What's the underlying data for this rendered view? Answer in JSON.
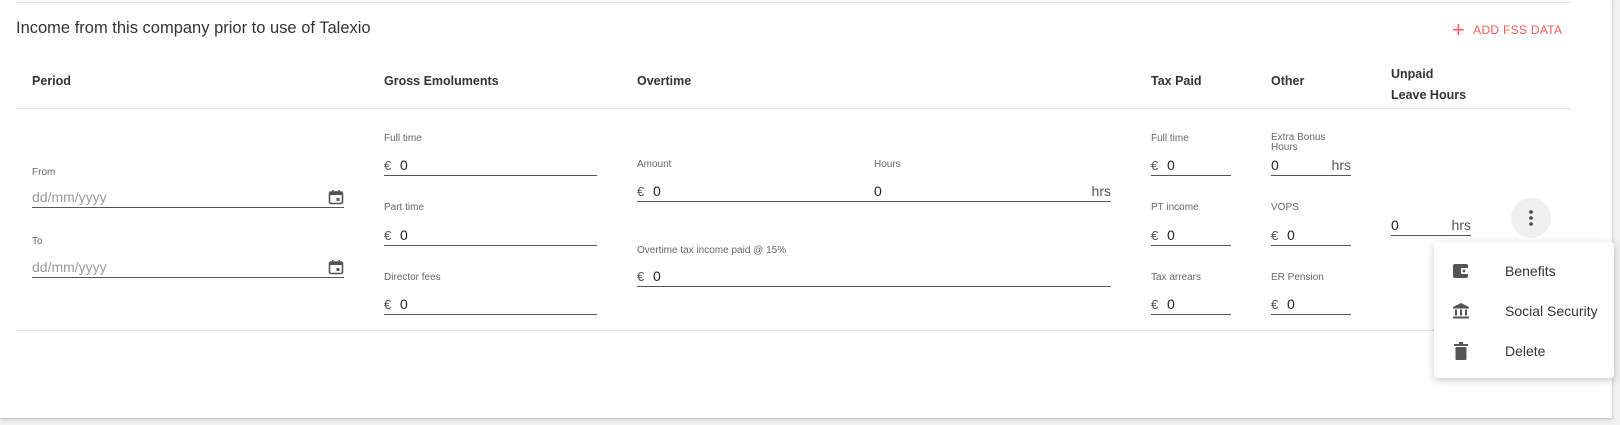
{
  "section": {
    "title": "Income from this company prior to use of Talexio",
    "add_button": "ADD FSS DATA"
  },
  "columns": {
    "period": "Period",
    "gross": "Gross Emoluments",
    "overtime": "Overtime",
    "tax_paid": "Tax Paid",
    "other": "Other",
    "unpaid": "Unpaid Leave Hours"
  },
  "period": {
    "from_label": "From",
    "from_placeholder": "dd/mm/yyyy",
    "to_label": "To",
    "to_placeholder": "dd/mm/yyyy"
  },
  "gross": {
    "full_time_label": "Full time",
    "full_time_value": "0",
    "part_time_label": "Part time",
    "part_time_value": "0",
    "director_label": "Director fees",
    "director_value": "0"
  },
  "overtime": {
    "amount_label": "Amount",
    "amount_value": "0",
    "hours_label": "Hours",
    "hours_value": "0",
    "tax_label": "Overtime tax income paid @ 15%",
    "tax_value": "0"
  },
  "tax_paid": {
    "full_time_label": "Full time",
    "full_time_value": "0",
    "pt_label": "PT income",
    "pt_value": "0",
    "arrears_label": "Tax arrears",
    "arrears_value": "0"
  },
  "other": {
    "bonus_label": "Extra Bonus Hours",
    "bonus_value": "0",
    "vops_label": "VOPS",
    "vops_value": "0",
    "er_label": "ER Pension",
    "er_value": "0"
  },
  "unpaid": {
    "value": "0"
  },
  "units": {
    "currency": "€",
    "hours": "hrs"
  },
  "menu": {
    "items": [
      {
        "label": "Benefits",
        "icon": "wallet-icon"
      },
      {
        "label": "Social Security",
        "icon": "bank-icon"
      },
      {
        "label": "Delete",
        "icon": "trash-icon"
      }
    ]
  },
  "colors": {
    "accent": "#f25c5c"
  }
}
